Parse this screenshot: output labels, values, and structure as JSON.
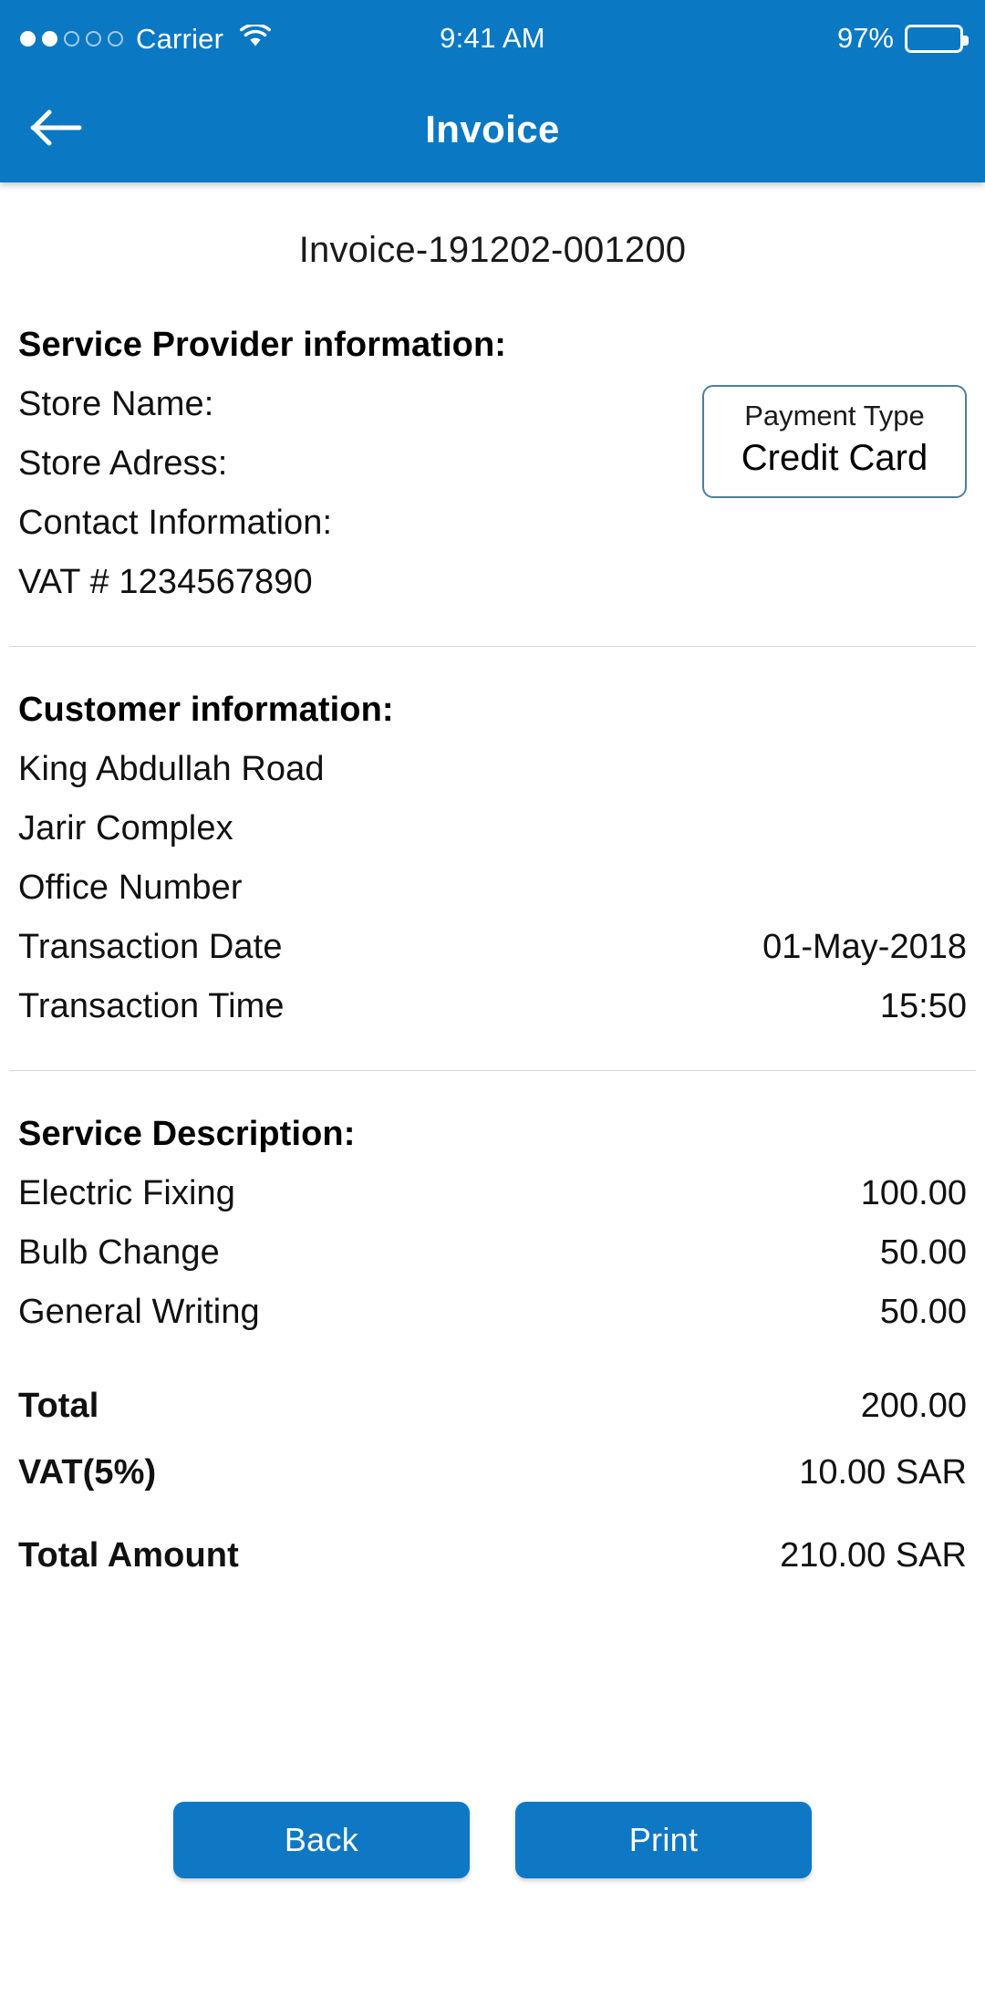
{
  "status_bar": {
    "carrier": "Carrier",
    "signal_dots_filled": 2,
    "signal_dots_total": 5,
    "wifi_icon": "wifi-icon",
    "time": "9:41 AM",
    "battery_percent": "97%",
    "battery_level": 97
  },
  "nav": {
    "back_icon": "arrow-left-icon",
    "title": "Invoice"
  },
  "invoice": {
    "number": "Invoice-191202-001200"
  },
  "provider": {
    "heading": "Service Provider information:",
    "lines": [
      "Store Name:",
      "Store Adress:",
      "Contact Information:",
      "VAT # 1234567890"
    ]
  },
  "payment": {
    "label": "Payment Type",
    "value": "Credit Card"
  },
  "customer": {
    "heading": "Customer information:",
    "address_lines": [
      "King Abdullah Road",
      "Jarir Complex",
      "Office Number"
    ],
    "rows": [
      {
        "label": "Transaction Date",
        "value": "01-May-2018"
      },
      {
        "label": "Transaction Time",
        "value": "15:50"
      }
    ]
  },
  "services": {
    "heading": "Service Description:",
    "items": [
      {
        "label": "Electric Fixing",
        "value": "100.00"
      },
      {
        "label": "Bulb Change",
        "value": "50.00"
      },
      {
        "label": "General Writing",
        "value": "50.00"
      }
    ]
  },
  "totals": {
    "subtotal": {
      "label": "Total",
      "value": "200.00"
    },
    "vat": {
      "label": "VAT(5%)",
      "value": "10.00 SAR"
    },
    "grand": {
      "label": "Total Amount",
      "value": "210.00 SAR"
    }
  },
  "actions": {
    "back_label": "Back",
    "print_label": "Print"
  },
  "colors": {
    "header_blue": "#0b78c4",
    "button_blue": "#0f78c4",
    "card_border": "#4d7f99",
    "divider": "#d6d6d6"
  }
}
